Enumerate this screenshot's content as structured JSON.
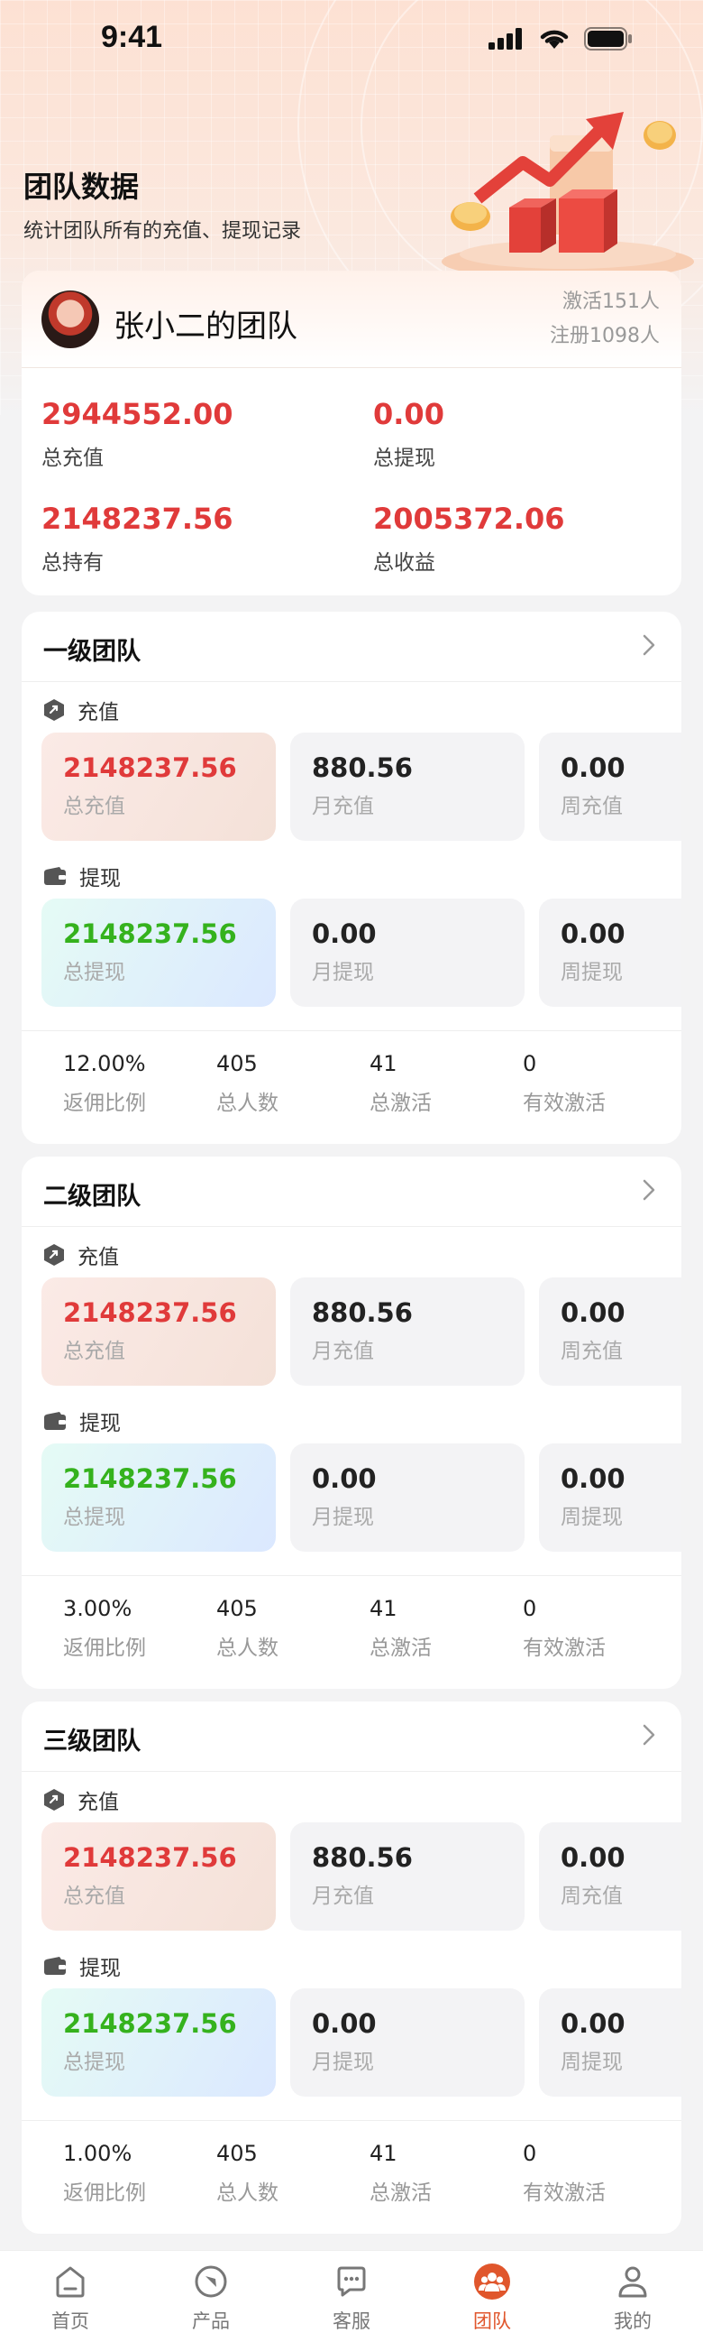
{
  "status": {
    "time": "9:41"
  },
  "header": {
    "title": "团队数据",
    "subtitle": "统计团队所有的充值、提现记录"
  },
  "summary": {
    "team_name": "张小二的团队",
    "activated": "激活151人",
    "registered": "注册1098人",
    "items": [
      {
        "value": "2944552.00",
        "label": "总充值"
      },
      {
        "value": "0.00",
        "label": "总提现"
      },
      {
        "value": "2148237.56",
        "label": "总持有"
      },
      {
        "value": "2005372.06",
        "label": "总收益"
      }
    ]
  },
  "teams": [
    {
      "title": "一级团队",
      "recharge_label": "充值",
      "withdraw_label": "提现",
      "recharge": [
        {
          "value": "2148237.56",
          "label": "总充值"
        },
        {
          "value": "880.56",
          "label": "月充值"
        },
        {
          "value": "0.00",
          "label": "周充值"
        }
      ],
      "withdraw": [
        {
          "value": "2148237.56",
          "label": "总提现"
        },
        {
          "value": "0.00",
          "label": "月提现"
        },
        {
          "value": "0.00",
          "label": "周提现"
        }
      ],
      "footer": [
        {
          "value": "12.00%",
          "label": "返佣比例"
        },
        {
          "value": "405",
          "label": "总人数"
        },
        {
          "value": "41",
          "label": "总激活"
        },
        {
          "value": "0",
          "label": "有效激活"
        }
      ]
    },
    {
      "title": "二级团队",
      "recharge_label": "充值",
      "withdraw_label": "提现",
      "recharge": [
        {
          "value": "2148237.56",
          "label": "总充值"
        },
        {
          "value": "880.56",
          "label": "月充值"
        },
        {
          "value": "0.00",
          "label": "周充值"
        }
      ],
      "withdraw": [
        {
          "value": "2148237.56",
          "label": "总提现"
        },
        {
          "value": "0.00",
          "label": "月提现"
        },
        {
          "value": "0.00",
          "label": "周提现"
        }
      ],
      "footer": [
        {
          "value": "3.00%",
          "label": "返佣比例"
        },
        {
          "value": "405",
          "label": "总人数"
        },
        {
          "value": "41",
          "label": "总激活"
        },
        {
          "value": "0",
          "label": "有效激活"
        }
      ]
    },
    {
      "title": "三级团队",
      "recharge_label": "充值",
      "withdraw_label": "提现",
      "recharge": [
        {
          "value": "2148237.56",
          "label": "总充值"
        },
        {
          "value": "880.56",
          "label": "月充值"
        },
        {
          "value": "0.00",
          "label": "周充值"
        }
      ],
      "withdraw": [
        {
          "value": "2148237.56",
          "label": "总提现"
        },
        {
          "value": "0.00",
          "label": "月提现"
        },
        {
          "value": "0.00",
          "label": "周提现"
        }
      ],
      "footer": [
        {
          "value": "1.00%",
          "label": "返佣比例"
        },
        {
          "value": "405",
          "label": "总人数"
        },
        {
          "value": "41",
          "label": "总激活"
        },
        {
          "value": "0",
          "label": "有效激活"
        }
      ]
    }
  ],
  "tabbar": {
    "active_index": 3,
    "active_color": "#e0562c",
    "items": [
      {
        "label": "首页",
        "icon": "home-icon"
      },
      {
        "label": "产品",
        "icon": "compass-icon"
      },
      {
        "label": "客服",
        "icon": "chat-icon"
      },
      {
        "label": "团队",
        "icon": "team-icon"
      },
      {
        "label": "我的",
        "icon": "user-icon"
      }
    ]
  }
}
